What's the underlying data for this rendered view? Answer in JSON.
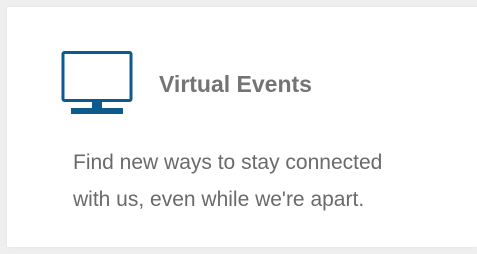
{
  "card": {
    "icon": "monitor-icon",
    "accent_color": "#0d5a8c",
    "title": "Virtual Events",
    "description_lines": [
      "Find new ways to stay connected",
      "with us, even while we're apart."
    ]
  }
}
